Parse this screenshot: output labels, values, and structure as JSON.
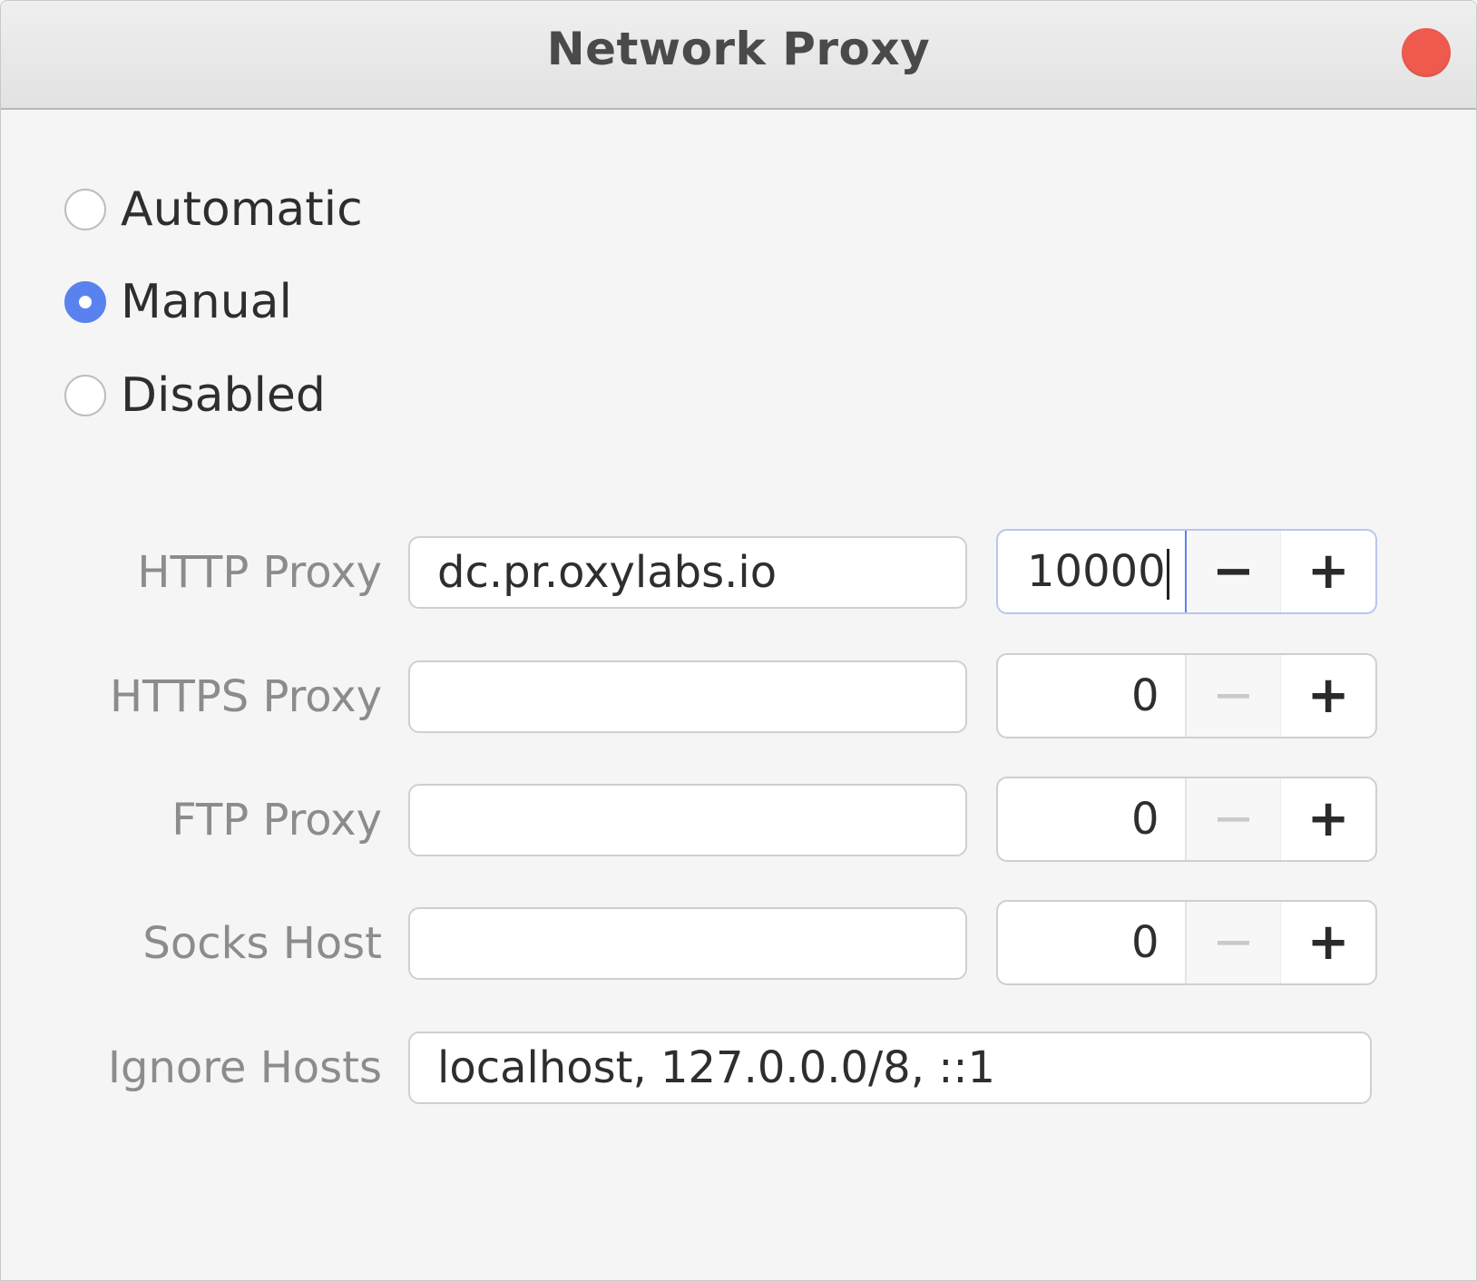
{
  "window": {
    "title": "Network Proxy",
    "close_color": "#ef5a4f"
  },
  "mode": {
    "options": [
      {
        "label": "Automatic",
        "checked": false
      },
      {
        "label": "Manual",
        "checked": true
      },
      {
        "label": "Disabled",
        "checked": false
      }
    ],
    "accent_color": "#5a82ef"
  },
  "proxies": {
    "http": {
      "label": "HTTP Proxy",
      "host": "dc.pr.oxylabs.io",
      "port": "10000"
    },
    "https": {
      "label": "HTTPS Proxy",
      "host": "",
      "port": "0"
    },
    "ftp": {
      "label": "FTP Proxy",
      "host": "",
      "port": "0"
    },
    "socks": {
      "label": "Socks Host",
      "host": "",
      "port": "0"
    }
  },
  "ignore_hosts": {
    "label": "Ignore Hosts",
    "value": "localhost, 127.0.0.0/8, ::1"
  },
  "spin_buttons": {
    "minus": "−",
    "plus": "+"
  }
}
